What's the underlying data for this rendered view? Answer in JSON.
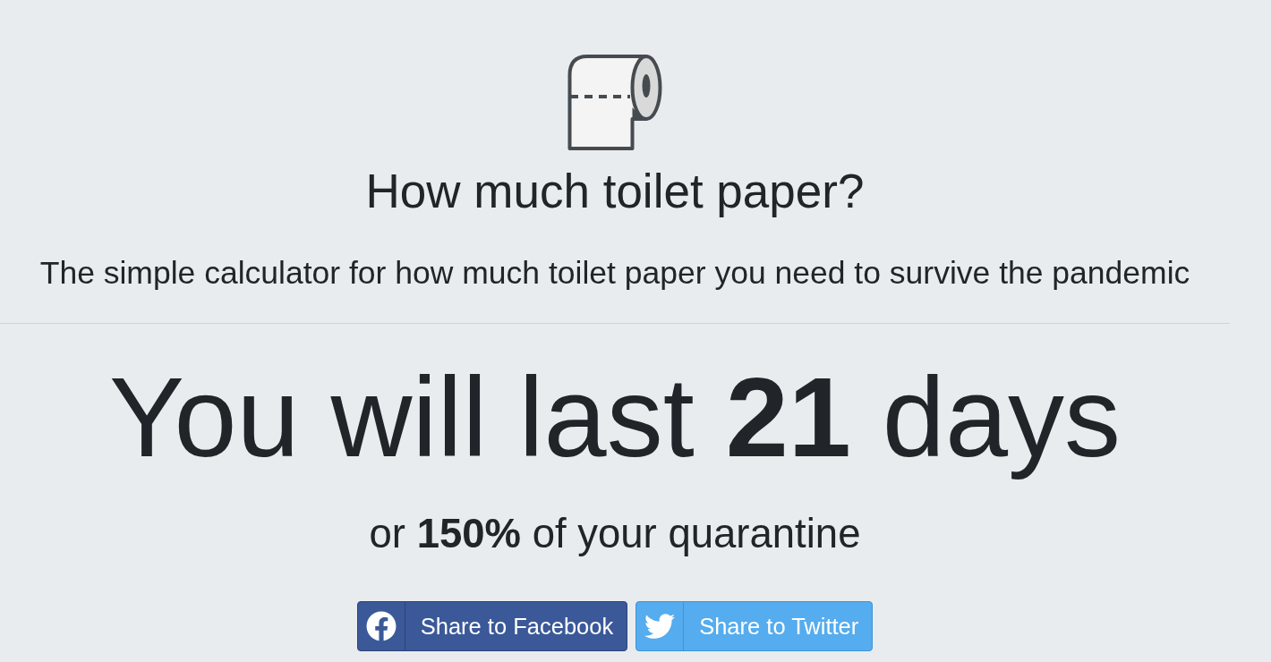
{
  "header": {
    "title": "How much toilet paper?",
    "subtitle": "The simple calculator for how much toilet paper you need to survive the pandemic"
  },
  "result": {
    "headline": "You will last **21** days",
    "detail": "or **150%** of your quarantine"
  },
  "share_buttons": [
    {
      "kind": "facebook",
      "label": "Share to Facebook"
    },
    {
      "kind": "twitter",
      "label": "Share to Twitter"
    }
  ]
}
